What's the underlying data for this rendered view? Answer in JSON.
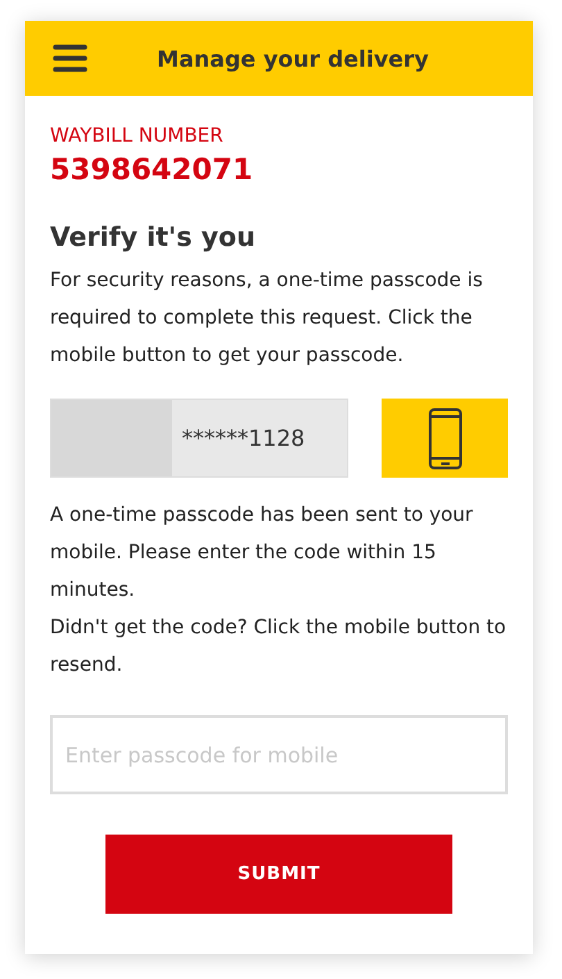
{
  "header": {
    "title": "Manage your delivery"
  },
  "waybill": {
    "label": "WAYBILL NUMBER",
    "number": "5398642071"
  },
  "heading": "Verify it's you",
  "intro": "For security reasons, a one-time passcode is required to complete this request. Click the mobile button to get your passcode.",
  "phone": {
    "value": "******1128"
  },
  "sent_notice": "A one-time passcode has been sent to your mobile. Please enter the code within 15 minutes.",
  "resend_notice": "Didn't get the code? Click the mobile button to resend.",
  "passcode": {
    "placeholder": "Enter passcode for mobile"
  },
  "submit": "SUBMIT"
}
